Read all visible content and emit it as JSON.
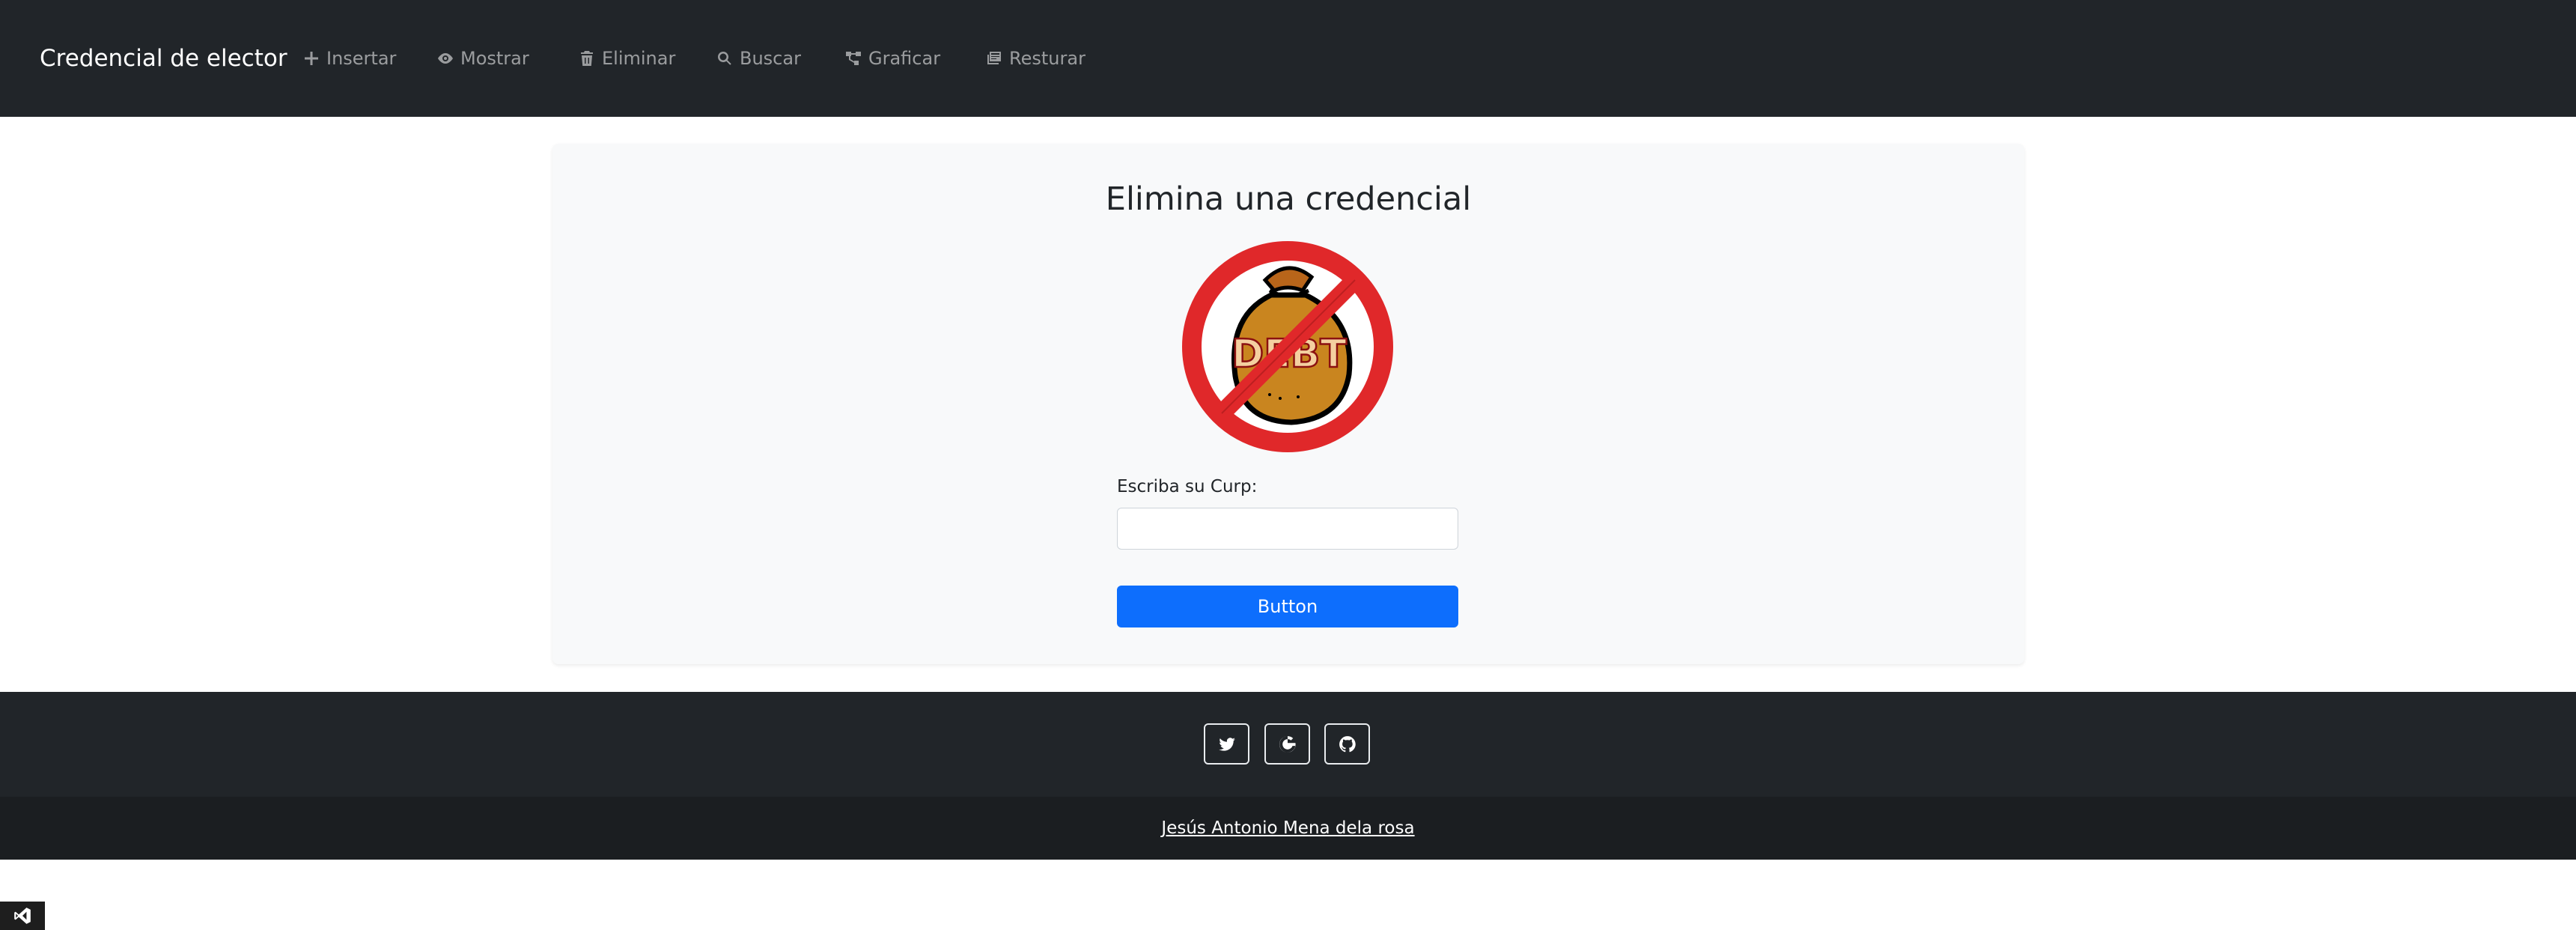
{
  "navbar": {
    "brand": "Credencial de elector",
    "items": [
      {
        "label": "Insertar",
        "icon": "plus-icon"
      },
      {
        "label": "Mostrar",
        "icon": "eye-icon"
      },
      {
        "label": "Eliminar",
        "icon": "trash-icon"
      },
      {
        "label": "Buscar",
        "icon": "search-icon"
      },
      {
        "label": "Graficar",
        "icon": "diagram-icon"
      },
      {
        "label": "Resturar",
        "icon": "restore-icon"
      }
    ]
  },
  "main": {
    "title": "Elimina una credencial",
    "image_text": "DEBT",
    "curp_label": "Escriba su Curp:",
    "curp_value": "",
    "button_label": "Button"
  },
  "footer": {
    "social": [
      "twitter-icon",
      "google-icon",
      "github-icon"
    ],
    "credit": "Jesús Antonio Mena dela rosa"
  },
  "colors": {
    "navbar_bg": "#212529",
    "primary": "#0d6efd",
    "card_bg": "#f8f9fa",
    "footer_bottom_bg": "#1b1e21"
  }
}
